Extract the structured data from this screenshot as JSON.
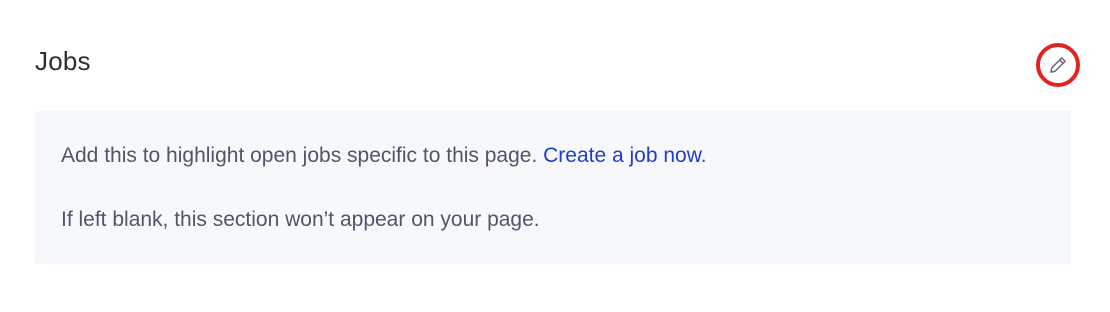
{
  "section": {
    "title": "Jobs",
    "edit_icon": "pencil-icon"
  },
  "info": {
    "line1_text": "Add this to highlight open jobs specific to this page. ",
    "line1_link": "Create a job now",
    "line1_suffix": ".",
    "line2_text": "If left blank, this section won’t appear on your page."
  },
  "colors": {
    "accent_link": "#1f3fc8",
    "edit_ring": "#e3231f",
    "box_background": "#f7f8fc"
  }
}
